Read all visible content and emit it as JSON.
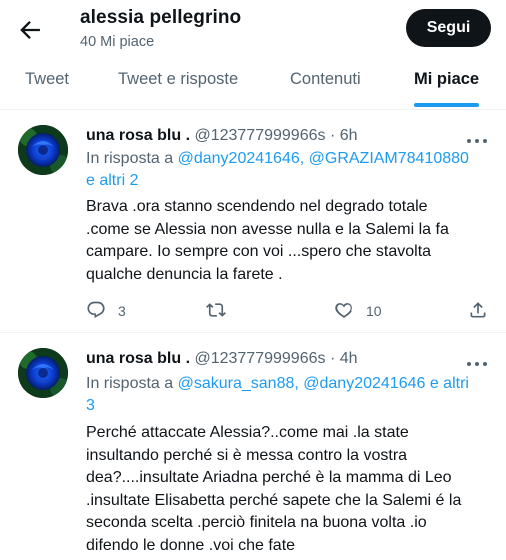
{
  "header": {
    "title": "alessia pellegrino",
    "subtitle": "40 Mi piace",
    "follow_label": "Segui"
  },
  "tabs": [
    {
      "label": "Tweet",
      "active": false
    },
    {
      "label": "Tweet e risposte",
      "active": false
    },
    {
      "label": "Contenuti",
      "active": false
    },
    {
      "label": "Mi piace",
      "active": true
    }
  ],
  "tweets": [
    {
      "name": "una rosa blu .",
      "handle": "@123777999966s",
      "separator": "·",
      "time": "6h",
      "reply_prefix": "In risposta a",
      "reply_mentions": "@dany20241646, @GRAZIAM78410880",
      "reply_more": "e altri 2",
      "text": "Brava .ora stanno scendendo nel degrado totale\n.come se Alessia non avesse nulla e la Salemi la fa\ncampare. Io sempre con voi ...spero che stavolta\nqualche denuncia la farete .",
      "replies": "3",
      "likes": "10"
    },
    {
      "name": "una rosa blu .",
      "handle": "@123777999966s",
      "separator": "·",
      "time": "4h",
      "reply_prefix": "In risposta a",
      "reply_mentions": "@sakura_san88, @dany20241646 e altri",
      "reply_more": "3",
      "text": "Perché attaccate Alessia?..come mai .la state\ninsultando perché si è messa contro la vostra\ndea?....insultate Ariadna  perché è la mamma di Leo\n.insultate Elisabetta perché sapete che la Salemi é la\nseconda scelta .perciò finitela na buona volta .io\ndifendo le donne .voi che fate"
    }
  ],
  "colors": {
    "accent": "#1d9bf0",
    "text": "#0f1419",
    "secondary": "#536471"
  },
  "icons": [
    "back-arrow-icon",
    "more-icon",
    "reply-icon",
    "retweet-icon",
    "like-icon",
    "share-icon"
  ]
}
